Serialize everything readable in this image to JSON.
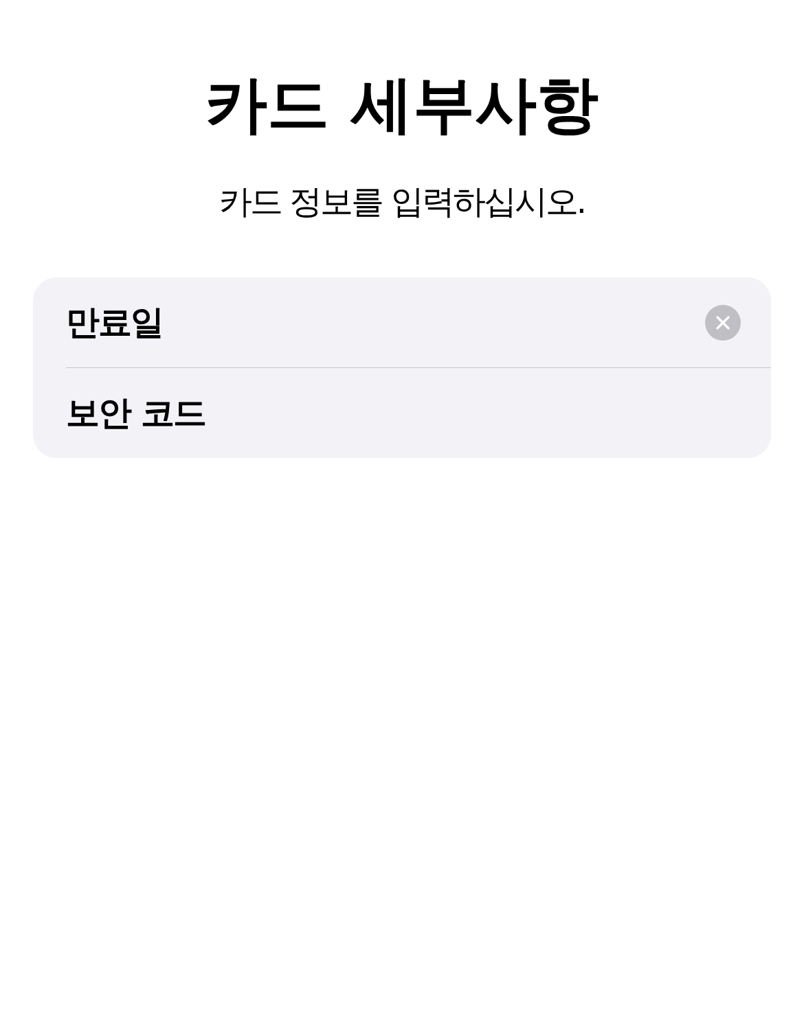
{
  "title": "카드 세부사항",
  "subtitle": "카드 정보를 입력하십시오.",
  "fields": [
    {
      "label": "만료일",
      "focused": true
    },
    {
      "label": "보안 코드",
      "focused": false
    }
  ]
}
